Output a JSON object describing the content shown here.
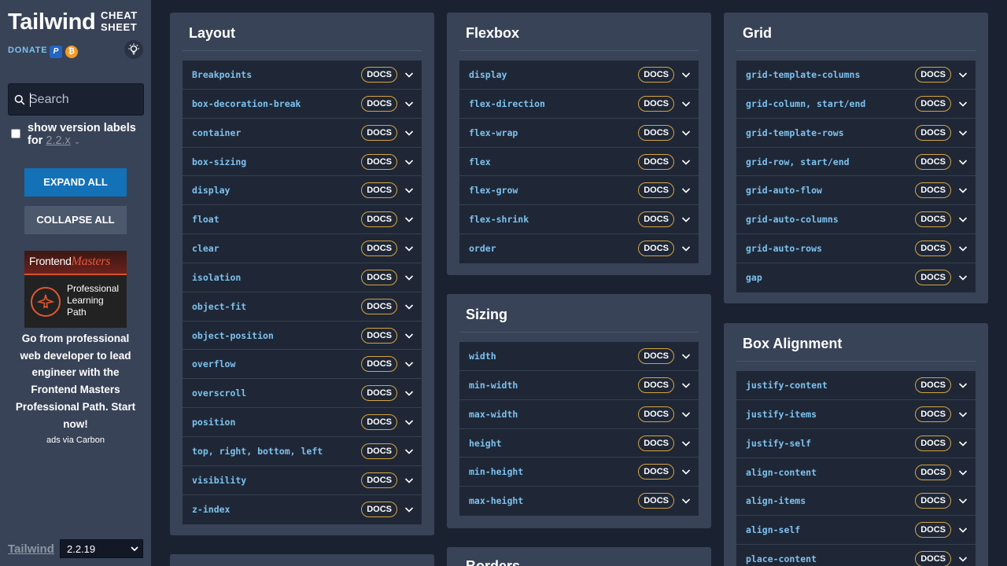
{
  "sidebar": {
    "brand_title": "Tailwind",
    "brand_sub_line1": "CHEAT",
    "brand_sub_line2": "SHEET",
    "donate_label": "DONATE",
    "search_placeholder": "Search",
    "version_label": "show version labels for",
    "version_value": "2.2.x",
    "expand_all": "EXPAND ALL",
    "collapse_all": "COLLAPSE ALL",
    "ad": {
      "logo_text": "Frontend",
      "logo_em": "Masters",
      "img_desc": "Professional Learning Path",
      "text": "Go from professional web developer to lead engineer with the Frontend Masters Professional Path. Start now!",
      "via": "ads via Carbon"
    },
    "footer_link": "Tailwind",
    "footer_version": "2.2.19"
  },
  "docs_label": "DOCS",
  "cards": {
    "layout": {
      "title": "Layout",
      "items": [
        "Breakpoints",
        "box-decoration-break",
        "container",
        "box-sizing",
        "display",
        "float",
        "clear",
        "isolation",
        "object-fit",
        "object-position",
        "overflow",
        "overscroll",
        "position",
        "top, right, bottom, left",
        "visibility",
        "z-index"
      ]
    },
    "flexbox": {
      "title": "Flexbox",
      "items": [
        "display",
        "flex-direction",
        "flex-wrap",
        "flex",
        "flex-grow",
        "flex-shrink",
        "order"
      ]
    },
    "sizing": {
      "title": "Sizing",
      "items": [
        "width",
        "min-width",
        "max-width",
        "height",
        "min-height",
        "max-height"
      ]
    },
    "grid": {
      "title": "Grid",
      "items": [
        "grid-template-columns",
        "grid-column, start/end",
        "grid-template-rows",
        "grid-row, start/end",
        "grid-auto-flow",
        "grid-auto-columns",
        "grid-auto-rows",
        "gap"
      ]
    },
    "box_alignment": {
      "title": "Box Alignment",
      "items": [
        "justify-content",
        "justify-items",
        "justify-self",
        "align-content",
        "align-items",
        "align-self",
        "place-content"
      ]
    },
    "borders": {
      "title": "Borders"
    }
  },
  "colors": {
    "background": "#1a2232",
    "panel": "#384357",
    "list_bg": "#1f2736",
    "link": "#7cc2ef",
    "docs_border": "#d5a443",
    "expand_btn": "#1371b7"
  }
}
